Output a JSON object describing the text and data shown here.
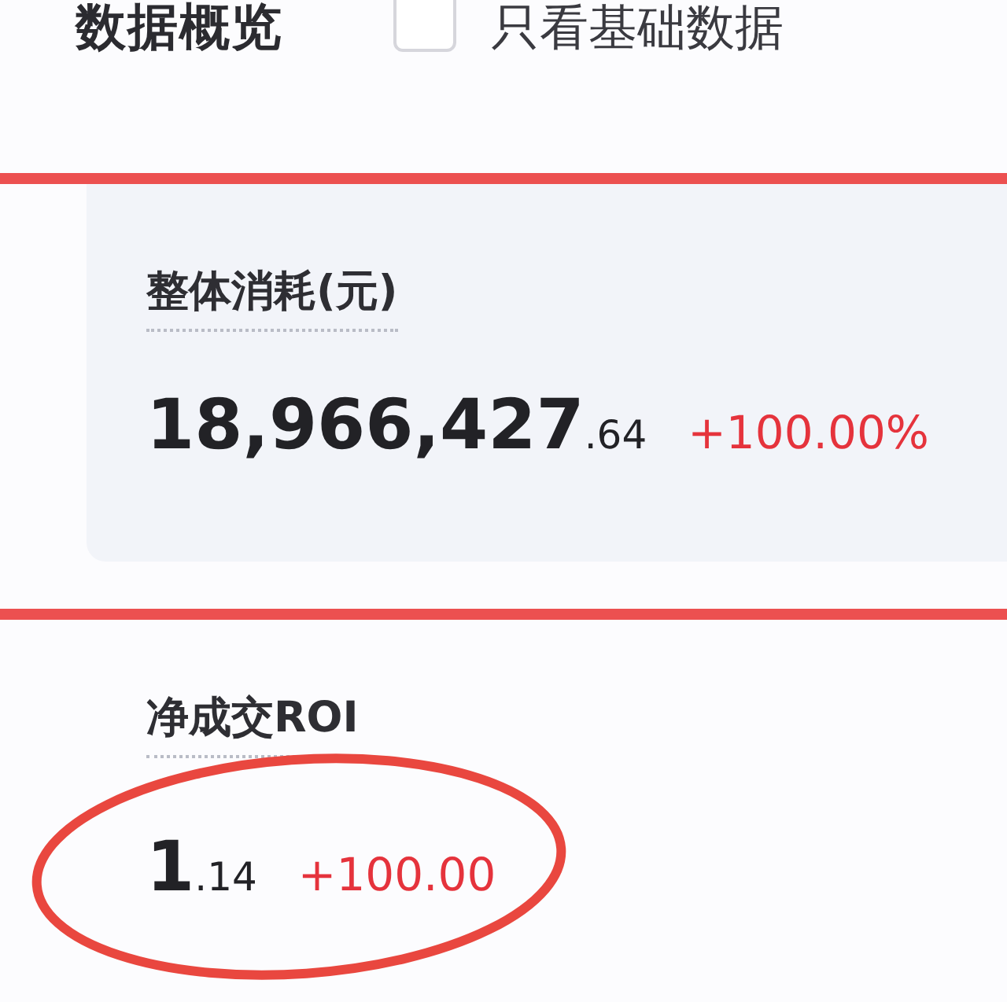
{
  "header": {
    "title": "数据概览",
    "checkbox": {
      "label": "只看基础数据",
      "checked": false
    }
  },
  "metrics": [
    {
      "label": "整体消耗(元)",
      "integer": "18,966,427",
      "fraction": ".64",
      "change": "+100.00%",
      "highlighted": false,
      "carded": true
    },
    {
      "label": "净成交ROI",
      "integer": "1",
      "fraction": ".14",
      "change": "+100.00",
      "highlighted": true,
      "carded": false
    }
  ]
}
